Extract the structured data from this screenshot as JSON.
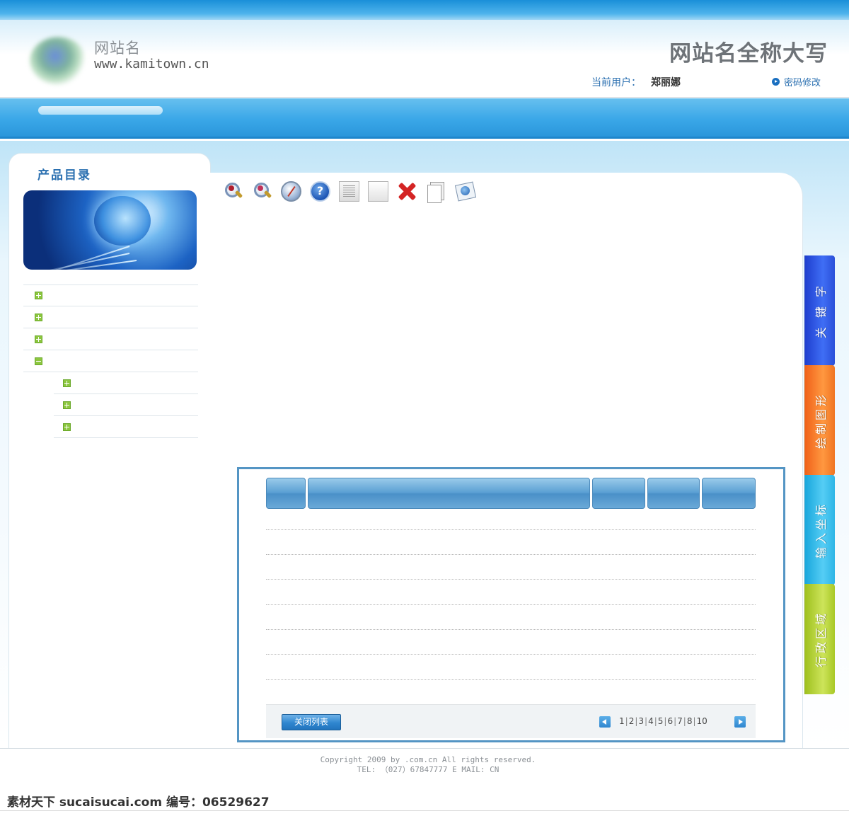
{
  "header": {
    "site_name": "网站名",
    "site_url": "www.kamitown.cn",
    "site_title": "网站名全称大写",
    "current_user_label": "当前用户：",
    "current_user_name": "郑丽娜",
    "change_password": "密码修改"
  },
  "sidebar": {
    "title": "产品目录",
    "items": [
      {
        "icon": "plus-icon",
        "label": ""
      },
      {
        "icon": "plus-icon",
        "label": ""
      },
      {
        "icon": "plus-icon",
        "label": ""
      },
      {
        "icon": "minus-icon",
        "label": ""
      }
    ],
    "sub_items": [
      {
        "icon": "plus-icon",
        "label": ""
      },
      {
        "icon": "plus-icon",
        "label": ""
      },
      {
        "icon": "plus-icon",
        "label": ""
      }
    ]
  },
  "toolbar": {
    "buttons": [
      "zoom-in-icon",
      "zoom-out-icon",
      "compass-icon",
      "help-icon",
      "list-icon",
      "blank-page-icon",
      "delete-icon",
      "copy-icon",
      "web-page-icon"
    ],
    "help_glyph": "?"
  },
  "list_panel": {
    "columns": [
      "",
      "",
      "",
      "",
      ""
    ],
    "row_count": 7,
    "close_button": "关闭列表",
    "pages": [
      "1",
      "2",
      "3",
      "4",
      "5",
      "6",
      "7",
      "8",
      "10"
    ]
  },
  "right_tabs": [
    {
      "label": "关 键 字",
      "color": "#2a4fd9"
    },
    {
      "label": "绘制图形",
      "color": "#f07422"
    },
    {
      "label": "输入坐标",
      "color": "#2db5e6"
    },
    {
      "label": "行政区域",
      "color": "#a8c826"
    }
  ],
  "footer": {
    "copyright": "Copyright 2009 by .com.cn All rights reserved.",
    "contact": "TEL: （027）67847777   E MAIL: CN"
  },
  "watermark": "素材天下 sucaisucai.com  编号：06529627"
}
